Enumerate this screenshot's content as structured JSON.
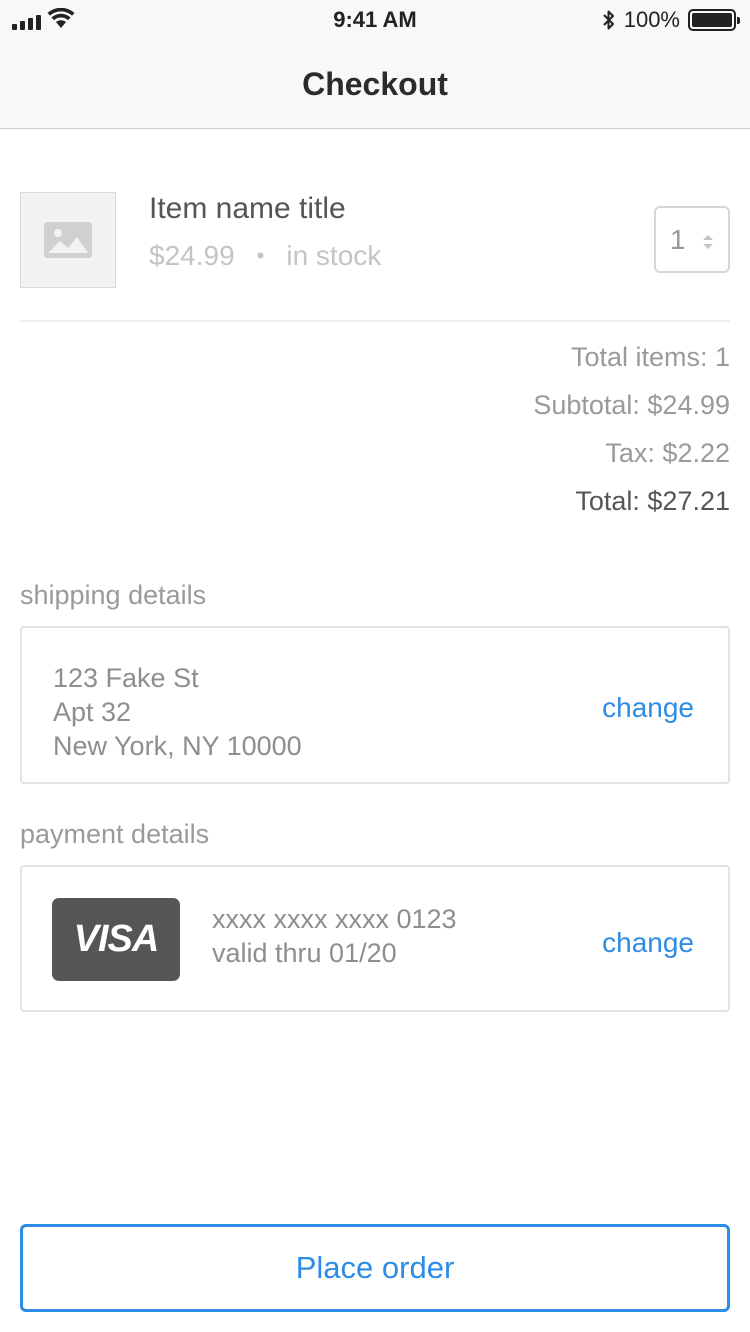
{
  "status_bar": {
    "time": "9:41 AM",
    "battery_text": "100%"
  },
  "nav": {
    "title": "Checkout"
  },
  "item": {
    "name": "Item name title",
    "price": "$24.99",
    "separator": "•",
    "stock": "in stock",
    "quantity": "1"
  },
  "totals": {
    "items": "Total items: 1",
    "subtotal": "Subtotal: $24.99",
    "tax": "Tax: $2.22",
    "total": "Total: $27.21"
  },
  "shipping": {
    "label": "shipping details",
    "line1": "123 Fake St",
    "line2": "Apt 32",
    "line3": "New York, NY 10000",
    "change_label": "change"
  },
  "payment": {
    "label": "payment details",
    "card_brand": "VISA",
    "card_number": "xxxx xxxx xxxx 0123",
    "valid_thru": "valid thru 01/20",
    "change_label": "change"
  },
  "actions": {
    "place_order": "Place order"
  },
  "colors": {
    "accent": "#2d8ce5",
    "visa_bg": "#555555"
  }
}
